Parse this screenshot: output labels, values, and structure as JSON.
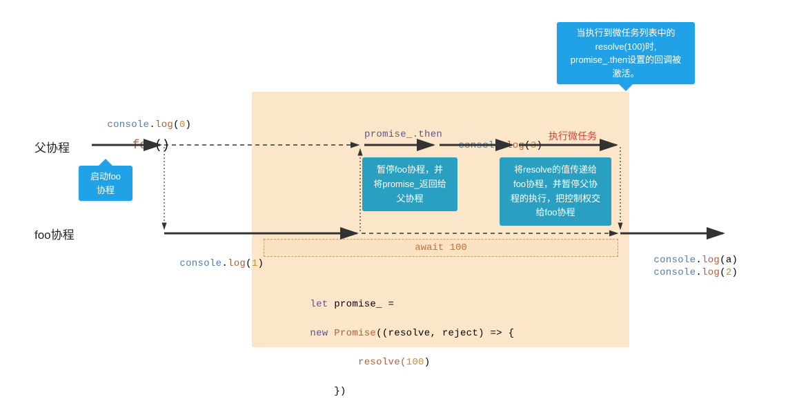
{
  "labels": {
    "parent": "父协程",
    "foo": "foo协程"
  },
  "top_code": {
    "log0": "console.log(0)",
    "call_foo": "foo()"
  },
  "top_row": {
    "promise_then": "promise_.then",
    "log3": "console.log(3)",
    "exec_micro": "执行微任务"
  },
  "callouts": {
    "top_right": "当执行到微任务列表中的\nresolve(100)时,\npromise_.then设置的回调被\n激活。",
    "start_foo": "启动foo\n协程",
    "pause_foo": "暂停foo协程，并\n将promise_返回给\n父协程",
    "resolve_pass": "将resolve的值传递给\nfoo协程，并暂停父协\n程的执行，把控制权交\n给foo协程"
  },
  "mid": {
    "log1": "console.log(1)",
    "await": "await 100"
  },
  "right_code": {
    "log_a": "console.log(a)",
    "log_2": "console.log(2)"
  },
  "bottom_code": {
    "let": "let ",
    "pvar": "promise_",
    "eq": " =",
    "newp": "new ",
    "prom": "Promise",
    "args": "((resolve, reject) => {",
    "resolve": "resolve(",
    "hundred": "100",
    "close_resolve": ")",
    "end": "})"
  }
}
